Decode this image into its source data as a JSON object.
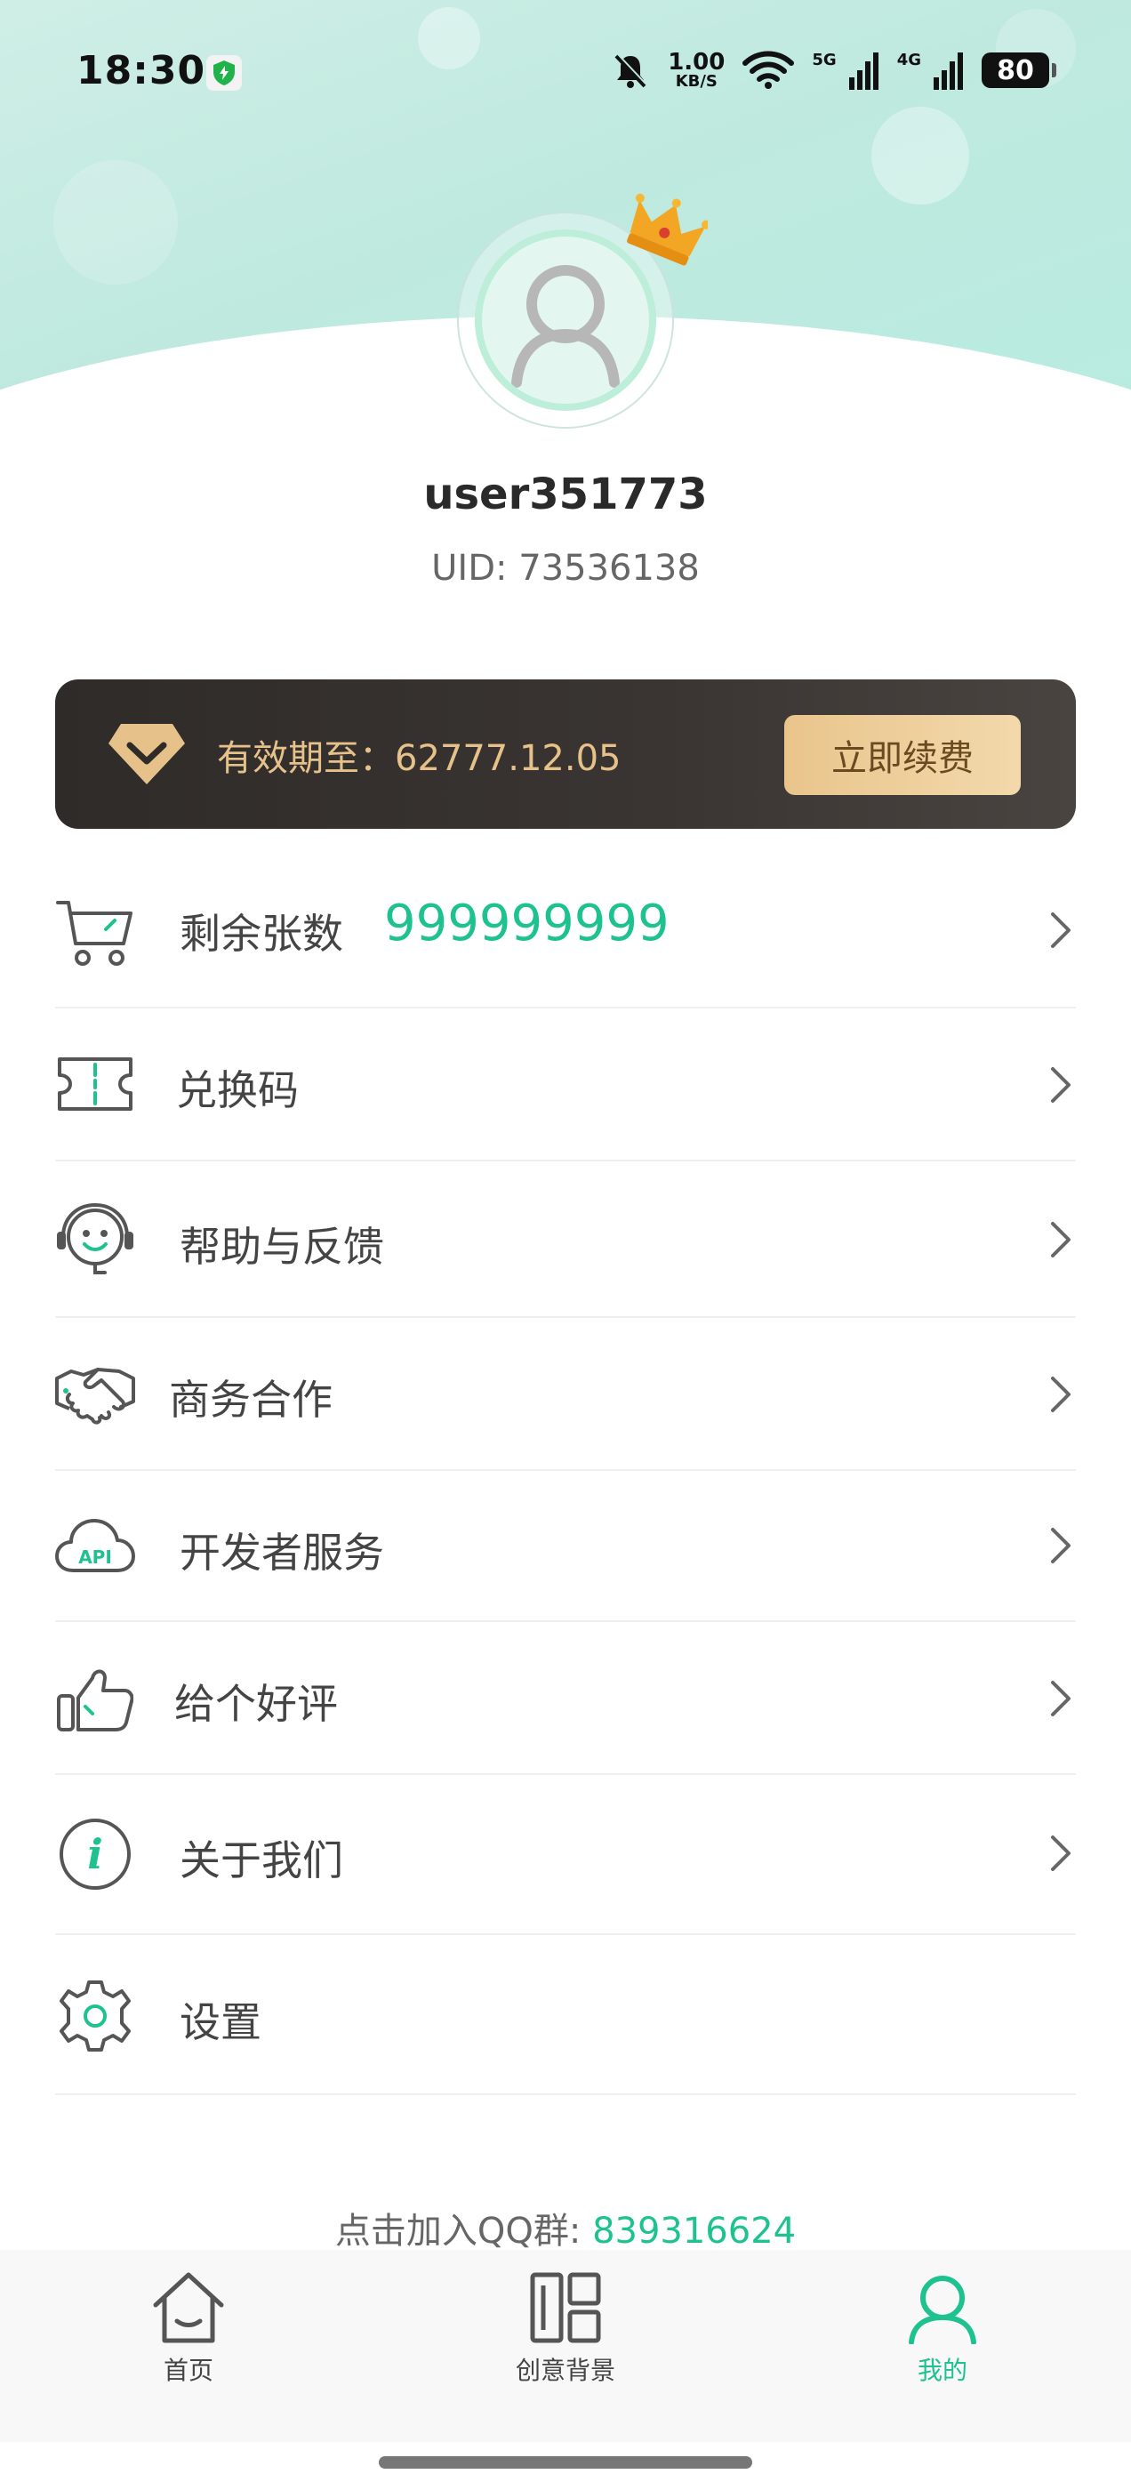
{
  "status_bar": {
    "time": "18:30",
    "net_speed_value": "1.00",
    "net_speed_unit": "KB/S",
    "signal1_label": "5G",
    "signal2_label": "4G",
    "battery": "80",
    "icons": [
      "shield-icon",
      "bell-muted-icon",
      "wifi-icon",
      "signal-icon",
      "battery-icon"
    ]
  },
  "profile": {
    "username": "user351773",
    "uid": "UID: 73536138",
    "avatar_icon": "user-avatar-icon",
    "badge_icon": "crown-icon"
  },
  "vip": {
    "expiry_text": "有效期至：62777.12.05",
    "renew_label": "立即续费",
    "icon": "diamond-icon"
  },
  "menu": {
    "items": [
      {
        "label": "剩余张数",
        "value": "999999999",
        "icon": "cart-icon"
      },
      {
        "label": "兑换码",
        "icon": "ticket-icon"
      },
      {
        "label": "帮助与反馈",
        "icon": "support-icon"
      },
      {
        "label": "商务合作",
        "icon": "handshake-icon"
      },
      {
        "label": "开发者服务",
        "icon": "api-cloud-icon",
        "icon_text": "API"
      },
      {
        "label": "给个好评",
        "icon": "thumbs-up-icon"
      },
      {
        "label": "关于我们",
        "icon": "info-icon",
        "icon_text": "i"
      },
      {
        "label": "设置",
        "icon": "settings-icon"
      }
    ]
  },
  "qq_group": {
    "prefix": "点击加入QQ群: ",
    "number": "839316624"
  },
  "bottom_nav": {
    "items": [
      {
        "label": "首页",
        "icon": "home-icon"
      },
      {
        "label": "创意背景",
        "icon": "layout-icon"
      },
      {
        "label": "我的",
        "icon": "profile-icon",
        "active": true
      }
    ]
  },
  "colors": {
    "accent": "#1ec28f",
    "gold": "#e6c28a",
    "card_dark": "#2f2b29"
  }
}
